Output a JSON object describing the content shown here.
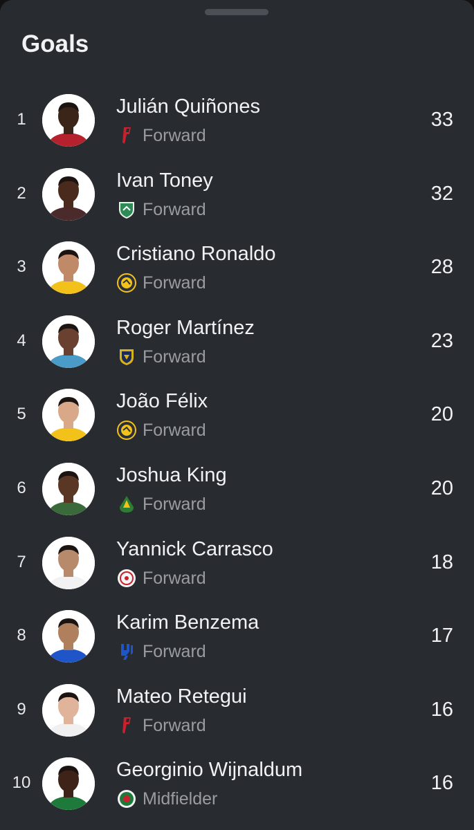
{
  "sheet": {
    "title": "Goals"
  },
  "players": [
    {
      "rank": "1",
      "name": "Julián Quiñones",
      "position": "Forward",
      "goals": "33",
      "club_icon": "red-club-crest-icon",
      "skin": "#3b2418",
      "shirt": "#b5212c"
    },
    {
      "rank": "2",
      "name": "Ivan Toney",
      "position": "Forward",
      "goals": "32",
      "club_icon": "green-shield-crest-icon",
      "skin": "#4a2a1c",
      "shirt": "#4a2a2a"
    },
    {
      "rank": "3",
      "name": "Cristiano Ronaldo",
      "position": "Forward",
      "goals": "28",
      "club_icon": "yellow-round-crest-icon",
      "skin": "#c08a68",
      "shirt": "#f2c21b"
    },
    {
      "rank": "4",
      "name": "Roger Martínez",
      "position": "Forward",
      "goals": "23",
      "club_icon": "yellow-navy-shield-crest-icon",
      "skin": "#6a4030",
      "shirt": "#4a9bc7"
    },
    {
      "rank": "5",
      "name": "João Félix",
      "position": "Forward",
      "goals": "20",
      "club_icon": "yellow-round-crest-icon",
      "skin": "#d8a888",
      "shirt": "#f2c21b"
    },
    {
      "rank": "6",
      "name": "Joshua King",
      "position": "Forward",
      "goals": "20",
      "club_icon": "green-yellow-crest-icon",
      "skin": "#5a3624",
      "shirt": "#3a6a3a"
    },
    {
      "rank": "7",
      "name": "Yannick Carrasco",
      "position": "Forward",
      "goals": "18",
      "club_icon": "white-round-crest-icon",
      "skin": "#b88a6c",
      "shirt": "#f2f2f2"
    },
    {
      "rank": "8",
      "name": "Karim Benzema",
      "position": "Forward",
      "goals": "17",
      "club_icon": "blue-club-crest-icon",
      "skin": "#b0805e",
      "shirt": "#1f55c8"
    },
    {
      "rank": "9",
      "name": "Mateo Retegui",
      "position": "Forward",
      "goals": "16",
      "club_icon": "red-club-crest-icon",
      "skin": "#e0b49a",
      "shirt": "#f0f0f0"
    },
    {
      "rank": "10",
      "name": "Georginio Wijnaldum",
      "position": "Midfielder",
      "goals": "16",
      "club_icon": "green-white-round-crest-icon",
      "skin": "#3e2418",
      "shirt": "#1e7a3a"
    }
  ],
  "colors": {
    "background": "#282b30",
    "text_primary": "#f1f2f4",
    "text_secondary": "#9a9ca1"
  }
}
